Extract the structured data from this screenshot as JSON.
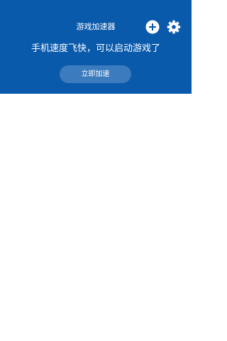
{
  "header": {
    "title": "游戏加速器",
    "headline": "手机速度飞快，可以启动游戏了",
    "accelerate_button_label": "立即加速",
    "add_icon": "plus-circle-icon",
    "settings_icon": "gear-icon"
  },
  "colors": {
    "header_background": "#0a5aac",
    "button_background": "#3c7bbd",
    "text_on_header": "#ffffff",
    "page_background": "#ffffff"
  }
}
